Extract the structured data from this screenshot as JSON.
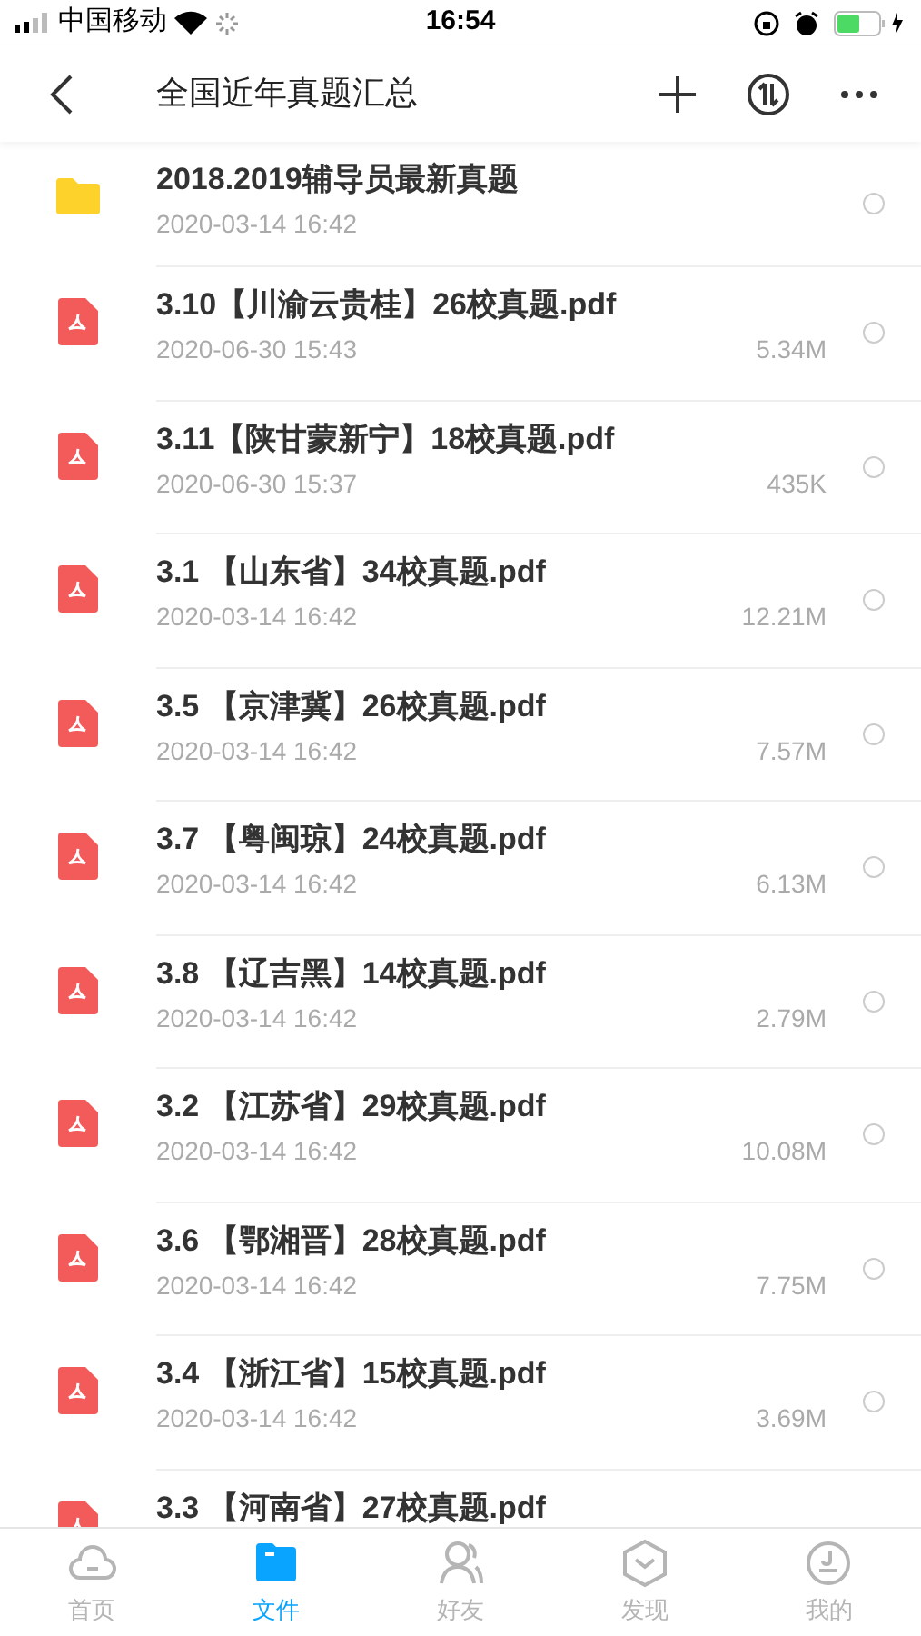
{
  "status_bar": {
    "carrier": "中国移动",
    "time": "16:54"
  },
  "header": {
    "title": "全国近年真题汇总"
  },
  "files": [
    {
      "kind": "folder",
      "name": "2018.2019辅导员最新真题",
      "date": "2020-03-14 16:42",
      "selected": false
    },
    {
      "kind": "pdf",
      "name": "3.10【川渝云贵桂】26校真题.pdf",
      "date": "2020-06-30 15:43",
      "size": "5.34M",
      "selected": false
    },
    {
      "kind": "pdf",
      "name": "3.11【陕甘蒙新宁】18校真题.pdf",
      "date": "2020-06-30 15:37",
      "size": "435K",
      "selected": false
    },
    {
      "kind": "pdf",
      "name": "3.1 【山东省】34校真题.pdf",
      "date": "2020-03-14 16:42",
      "size": "12.21M",
      "selected": false
    },
    {
      "kind": "pdf",
      "name": "3.5 【京津冀】26校真题.pdf",
      "date": "2020-03-14 16:42",
      "size": "7.57M",
      "selected": false
    },
    {
      "kind": "pdf",
      "name": "3.7 【粤闽琼】24校真题.pdf",
      "date": "2020-03-14 16:42",
      "size": "6.13M",
      "selected": false
    },
    {
      "kind": "pdf",
      "name": "3.8 【辽吉黑】14校真题.pdf",
      "date": "2020-03-14 16:42",
      "size": "2.79M",
      "selected": false
    },
    {
      "kind": "pdf",
      "name": "3.2 【江苏省】29校真题.pdf",
      "date": "2020-03-14 16:42",
      "size": "10.08M",
      "selected": false
    },
    {
      "kind": "pdf",
      "name": "3.6 【鄂湘晋】28校真题.pdf",
      "date": "2020-03-14 16:42",
      "size": "7.75M",
      "selected": false
    },
    {
      "kind": "pdf",
      "name": "3.4 【浙江省】15校真题.pdf",
      "date": "2020-03-14 16:42",
      "size": "3.69M",
      "selected": false
    },
    {
      "kind": "pdf",
      "name": "3.3 【河南省】27校真题.pdf"
    }
  ],
  "tabs": [
    {
      "kind": "home",
      "label": "首页",
      "selected": false
    },
    {
      "kind": "files",
      "label": "文件",
      "selected": true
    },
    {
      "kind": "friends",
      "label": "好友",
      "selected": false
    },
    {
      "kind": "discover",
      "label": "发现",
      "selected": false
    },
    {
      "kind": "me",
      "label": "我的",
      "selected": false
    }
  ]
}
